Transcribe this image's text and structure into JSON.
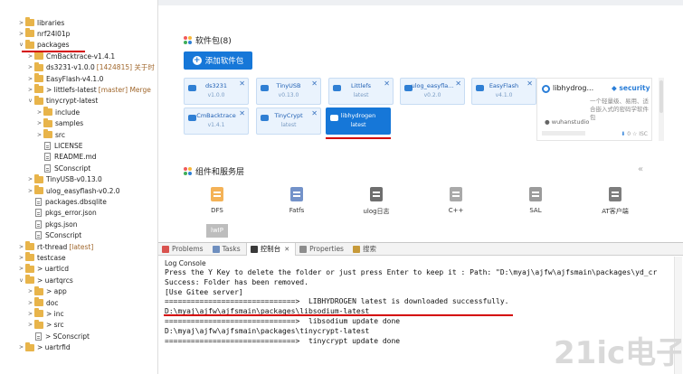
{
  "tree": {
    "items": [
      {
        "label": "libraries",
        "deco": "",
        "type": "folder",
        "toggle": ">",
        "indent": 0
      },
      {
        "label": "nrf24l01p",
        "deco": "",
        "type": "folder",
        "toggle": ">",
        "indent": 0
      },
      {
        "label": "packages",
        "deco": "",
        "type": "folder",
        "toggle": "v",
        "indent": 0
      },
      {
        "label": "CmBacktrace-v1.4.1",
        "deco": "",
        "type": "folder",
        "toggle": ">",
        "indent": 1
      },
      {
        "label": "ds3231-v1.0.0",
        "deco": "[1424815] 关于时",
        "type": "folder",
        "toggle": ">",
        "indent": 1
      },
      {
        "label": "EasyFlash-v4.1.0",
        "deco": "",
        "type": "folder",
        "toggle": ">",
        "indent": 1
      },
      {
        "label": "> littlefs-latest",
        "deco": "[master] Merge",
        "type": "folder",
        "toggle": ">",
        "indent": 1
      },
      {
        "label": "tinycrypt-latest",
        "deco": "",
        "type": "folder",
        "toggle": "v",
        "indent": 1
      },
      {
        "label": "include",
        "deco": "",
        "type": "folder",
        "toggle": ">",
        "indent": 2
      },
      {
        "label": "samples",
        "deco": "",
        "type": "folder",
        "toggle": ">",
        "indent": 2
      },
      {
        "label": "src",
        "deco": "",
        "type": "folder",
        "toggle": ">",
        "indent": 2
      },
      {
        "label": "LICENSE",
        "deco": "",
        "type": "file",
        "toggle": "",
        "indent": 2
      },
      {
        "label": "README.md",
        "deco": "",
        "type": "file",
        "toggle": "",
        "indent": 2
      },
      {
        "label": "SConscript",
        "deco": "",
        "type": "file",
        "toggle": "",
        "indent": 2
      },
      {
        "label": "TinyUSB-v0.13.0",
        "deco": "",
        "type": "folder",
        "toggle": ">",
        "indent": 1
      },
      {
        "label": "ulog_easyflash-v0.2.0",
        "deco": "",
        "type": "folder",
        "toggle": ">",
        "indent": 1
      },
      {
        "label": "packages.dbsqlite",
        "deco": "",
        "type": "file",
        "toggle": "",
        "indent": 1
      },
      {
        "label": "pkgs_error.json",
        "deco": "",
        "type": "file",
        "toggle": "",
        "indent": 1
      },
      {
        "label": "pkgs.json",
        "deco": "",
        "type": "file",
        "toggle": "",
        "indent": 1
      },
      {
        "label": "SConscript",
        "deco": "",
        "type": "file",
        "toggle": "",
        "indent": 1
      },
      {
        "label": "rt-thread",
        "deco": "[latest]",
        "type": "folder",
        "toggle": ">",
        "indent": 0
      },
      {
        "label": "testcase",
        "deco": "",
        "type": "folder",
        "toggle": ">",
        "indent": 0
      },
      {
        "label": "> uartlcd",
        "deco": "",
        "type": "folder",
        "toggle": ">",
        "indent": 0
      },
      {
        "label": "> uartqrcs",
        "deco": "",
        "type": "folder",
        "toggle": "v",
        "indent": 0
      },
      {
        "label": "> app",
        "deco": "",
        "type": "folder",
        "toggle": ">",
        "indent": 1
      },
      {
        "label": "doc",
        "deco": "",
        "type": "folder",
        "toggle": ">",
        "indent": 1
      },
      {
        "label": "> inc",
        "deco": "",
        "type": "folder",
        "toggle": ">",
        "indent": 1
      },
      {
        "label": "> src",
        "deco": "",
        "type": "folder",
        "toggle": ">",
        "indent": 1
      },
      {
        "label": "> SConscript",
        "deco": "",
        "type": "file",
        "toggle": "",
        "indent": 1
      },
      {
        "label": "> uartrfid",
        "deco": "",
        "type": "folder",
        "toggle": ">",
        "indent": 0
      }
    ]
  },
  "packages": {
    "heading": "软件包(8)",
    "add_button": "添加软件包",
    "cards": [
      {
        "name": "ds3231",
        "version": "v1.0.0",
        "selected": false
      },
      {
        "name": "TinyUSB",
        "version": "v0.13.0",
        "selected": false
      },
      {
        "name": "Littlefs",
        "version": "latest",
        "selected": false
      },
      {
        "name": "ulog_easyfla...",
        "version": "v0.2.0",
        "selected": false
      },
      {
        "name": "EasyFlash",
        "version": "v4.1.0",
        "selected": false
      },
      {
        "name": "CmBacktrace",
        "version": "v1.4.1",
        "selected": false
      },
      {
        "name": "TinyCrypt",
        "version": "latest",
        "selected": false
      },
      {
        "name": "libhydrogen",
        "version": "latest",
        "selected": true
      }
    ],
    "close_glyph": "✕",
    "detail": {
      "name": "libhydrog...",
      "tag": "security",
      "description": "一个轻量级、易用、适合嵌入式的密码学软件包",
      "author": "wuhanstudio",
      "stats": "0 ☆ ISC"
    }
  },
  "services": {
    "heading": "组件和服务层",
    "collapse": "«",
    "items": [
      {
        "label": "DFS",
        "color": "#f2a43a"
      },
      {
        "label": "Fatfs",
        "color": "#5b7fbf"
      },
      {
        "label": "ulog日志",
        "color": "#555555"
      },
      {
        "label": "C++",
        "color": "#9a9a9a"
      },
      {
        "label": "SAL",
        "color": "#8a8a8a"
      },
      {
        "label": "AT客户端",
        "color": "#666666"
      }
    ],
    "row2": [
      {
        "label": "lwIP"
      }
    ]
  },
  "console": {
    "tabs": [
      {
        "label": "Problems",
        "color": "#d9534f",
        "active": false
      },
      {
        "label": "Tasks",
        "color": "#6f8fbf",
        "active": false
      },
      {
        "label": "控制台",
        "color": "#3a3a3a",
        "active": true
      },
      {
        "label": "Properties",
        "color": "#8d8d8d",
        "active": false
      },
      {
        "label": "搜索",
        "color": "#c79a3a",
        "active": false
      }
    ],
    "tab_close": "✕",
    "title": "Log Console",
    "lines": [
      "Press the Y Key to delete the folder or just press Enter to keep it : Path: \"D:\\myaj\\ajfw\\ajfsmain\\packages\\yd_cr",
      "Success: Folder has been removed.",
      "[Use Gitee server]",
      "==============================>  LIBHYDROGEN latest is downloaded successfully.",
      "D:\\myaj\\ajfw\\ajfsmain\\packages\\libsodium-latest",
      "==============================>  libsodium update done",
      "D:\\myaj\\ajfw\\ajfsmain\\packages\\tinycrypt-latest",
      "==============================>  tinycrypt update done"
    ]
  },
  "watermark": {
    "text": "21ic电子网"
  },
  "colors": {
    "accent": "#1677d8",
    "highlight": "#d40000"
  }
}
